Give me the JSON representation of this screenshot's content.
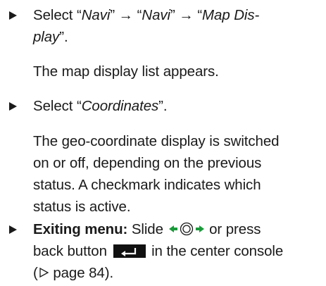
{
  "step1": {
    "prefix": "Select “",
    "menu1": "Navi",
    "sep1": "” → “",
    "menu2": "Navi",
    "sep2": "” → “",
    "menu3_part1": "Map Dis-",
    "menu3_part2": "play",
    "suffix": "”."
  },
  "result1": "The map display list appears.",
  "step2": {
    "prefix": "Select “",
    "option": "Coordinates",
    "suffix": "”."
  },
  "result2": {
    "line1": "The geo-coordinate display is switched",
    "line2": "on or off, depending on the previous",
    "line3": "status. A checkmark indicates which",
    "line4": "status is active."
  },
  "step3": {
    "label": "Exiting menu:",
    "text1": " Slide ",
    "text2": " or press",
    "text3": "back button ",
    "text4": " in the center console",
    "ref_open": "(",
    "ref_text": " page 84)."
  },
  "icons": {
    "bullet": "triangle-bullet-icon",
    "slide": "slide-left-right-controller-icon",
    "back": "back-button-icon",
    "page_ref": "page-reference-triangle-icon"
  },
  "colors": {
    "text": "#1a1a1a",
    "slide_arrows": "#1a9a3a",
    "back_button": "#111111"
  }
}
